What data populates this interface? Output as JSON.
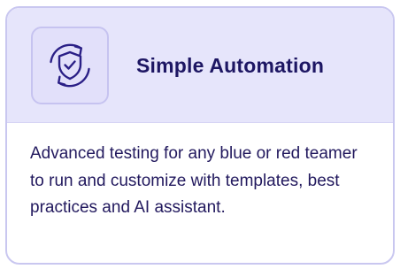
{
  "card": {
    "icon": "shield-sync-icon",
    "title": "Simple Automation",
    "description": "Advanced testing for any blue or red teamer to run and customize with templates, best practices and AI assistant."
  },
  "colors": {
    "accent": "#1d1663",
    "header_bg": "#e6e5fb",
    "border": "#c9c7f0"
  }
}
